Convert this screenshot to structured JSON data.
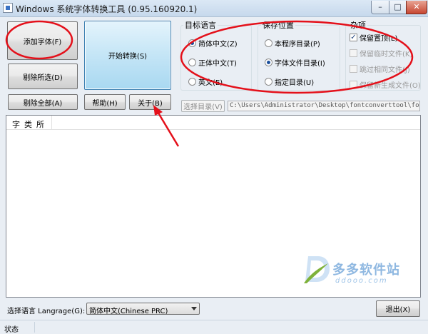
{
  "window": {
    "title": "Windows 系统字体转换工具 (0.95.160920.1)",
    "controls": {
      "minimize": "–",
      "maximize": "□",
      "close": "✕"
    }
  },
  "buttons": {
    "add_font": "添加字体(F)",
    "start_convert": "开始转换(S)",
    "remove_selected": "剔除所选(D)",
    "remove_all": "剔除全部(A)",
    "help": "帮助(H)",
    "about": "关于(B)",
    "choose_dir": "选择目录(V)",
    "exit": "退出(X)"
  },
  "target_language": {
    "label": "目标语言",
    "options": [
      {
        "label": "简体中文(Z)",
        "selected": true
      },
      {
        "label": "正体中文(T)",
        "selected": false
      },
      {
        "label": "英文(E)",
        "selected": false
      }
    ]
  },
  "save_location": {
    "label": "保存位置",
    "options": [
      {
        "label": "本程序目录(P)",
        "selected": false
      },
      {
        "label": "字体文件目录(I)",
        "selected": true
      },
      {
        "label": "指定目录(U)",
        "selected": false
      }
    ]
  },
  "misc": {
    "label": "杂项",
    "options": [
      {
        "label": "保留置顶(L)",
        "checked": true,
        "enabled": true
      },
      {
        "label": "保留临时文件(K)",
        "checked": false,
        "enabled": false
      },
      {
        "label": "跳过相同文件(J)",
        "checked": false,
        "enabled": false
      },
      {
        "label": "保留新生成文件(O)",
        "checked": false,
        "enabled": false
      }
    ]
  },
  "path": {
    "value": "C:\\Users\\Administrator\\Desktop\\fontconverttool\\fontconve"
  },
  "list": {
    "column_header": "字类所"
  },
  "watermark": {
    "text": "多多软件站",
    "sub": "ddooo.com"
  },
  "language_select": {
    "label": "选择语言 Langrage(G):",
    "value": "简体中文(Chinese PRC)"
  },
  "status": {
    "text": "状态"
  },
  "colors": {
    "annotation": "#e4101a",
    "start_button": "#a8d8f1",
    "watermark": "#8fb8e1"
  }
}
